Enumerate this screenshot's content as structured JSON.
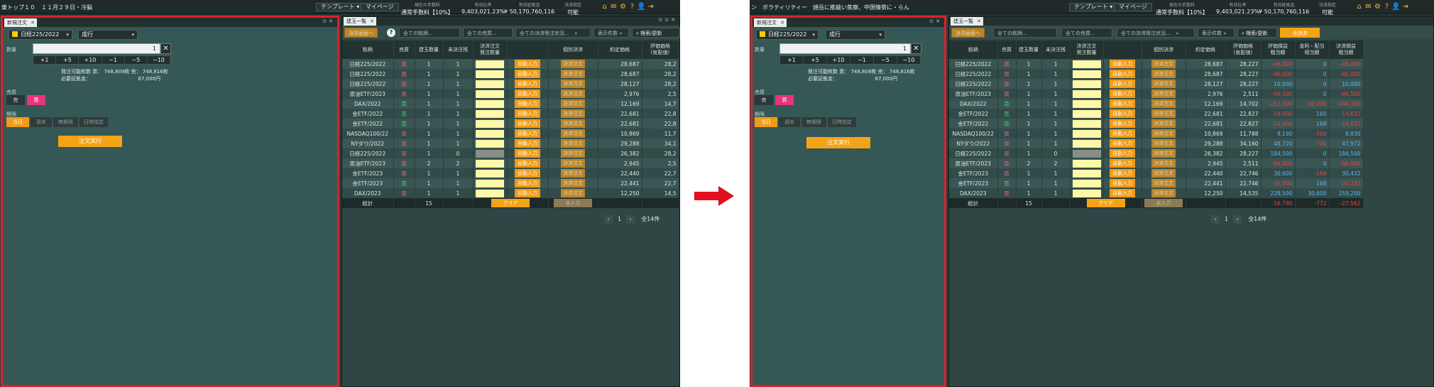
{
  "left": {
    "topbar": {
      "ticker": "東トップ１０　１１月２９日・冷脳",
      "template_label": "テンプレート",
      "mypage_label": "マイページ",
      "stats": [
        {
          "label": "現在の手数料",
          "value": "通常手数料【10%】"
        },
        {
          "label": "有効比率",
          "value": "9,403,021.23%"
        },
        {
          "label": "有効証拠金",
          "value": "¥ 50,170,760,116"
        },
        {
          "label": "決済指定",
          "value": "可能"
        }
      ],
      "icons": [
        "⌂",
        "✉",
        "⚙",
        "?",
        "👤",
        "⇥"
      ]
    },
    "order_panel": {
      "tab": "新規注文",
      "symbol": "日経225/2022",
      "order_type": "成行",
      "qty_label": "数量",
      "qty_value": "1",
      "steps": [
        "+1",
        "+5",
        "+10",
        "−1",
        "−5",
        "−10"
      ],
      "info_line1": "発注可能枚数 買： 748,809枚 売： 748,816枚",
      "info_line2": "必要証拠金：　　　　　　　　　　67,000円",
      "side_label": "売買",
      "sell": "売",
      "buy": "買",
      "period_label": "期限",
      "periods": [
        "当日",
        "週末",
        "無期限",
        "日時指定"
      ],
      "execute": "注文実行"
    },
    "positions": {
      "tab": "建玉一覧",
      "toolbar": {
        "settle_all": "決済画面へ",
        "all_products": "全ての銘柄...",
        "all_sides": "全ての売買...",
        "all_status": "全ての決済発注状況...",
        "display_count": "表示件数",
        "search": "検索/更新"
      },
      "headers": [
        "銘柄",
        "売買",
        "建玉数量",
        "未決注残",
        "決済注文\n発注数量",
        "",
        "個別決済",
        "約定価格",
        "評価価格\n(気配値)"
      ],
      "rows": [
        {
          "name": "日経225/2022",
          "side": "買",
          "qty": "1",
          "open": "1",
          "auto": "自動入力",
          "settle": "決済注文",
          "price": "28,687",
          "eval": "28,2"
        },
        {
          "name": "日経225/2022",
          "side": "買",
          "qty": "1",
          "open": "1",
          "auto": "自動入力",
          "settle": "決済注文",
          "price": "28,687",
          "eval": "28,2"
        },
        {
          "name": "日経225/2022",
          "side": "買",
          "qty": "1",
          "open": "1",
          "auto": "自動入力",
          "settle": "決済注文",
          "price": "28,127",
          "eval": "28,2"
        },
        {
          "name": "原油ETF/2023",
          "side": "買",
          "qty": "1",
          "open": "1",
          "auto": "自動入力",
          "settle": "決済注文",
          "price": "2,976",
          "eval": "2,5"
        },
        {
          "name": "DAX/2022",
          "side": "売",
          "qty": "1",
          "open": "1",
          "auto": "自動入力",
          "settle": "決済注文",
          "price": "12,169",
          "eval": "14,7"
        },
        {
          "name": "金ETF/2022",
          "side": "売",
          "qty": "1",
          "open": "1",
          "auto": "自動入力",
          "settle": "決済注文",
          "price": "22,681",
          "eval": "22,8"
        },
        {
          "name": "金ETF/2022",
          "side": "売",
          "qty": "1",
          "open": "1",
          "auto": "自動入力",
          "settle": "決済注文",
          "price": "22,681",
          "eval": "22,8"
        },
        {
          "name": "NASDAQ100/22",
          "side": "買",
          "qty": "1",
          "open": "1",
          "auto": "自動入力",
          "settle": "決済注文",
          "price": "10,869",
          "eval": "11,7"
        },
        {
          "name": "NYダウ/2022",
          "side": "買",
          "qty": "1",
          "open": "1",
          "auto": "自動入力",
          "settle": "決済注文",
          "price": "29,288",
          "eval": "34,1"
        },
        {
          "name": "日経225/2022",
          "side": "買",
          "qty": "1",
          "open": "0",
          "auto": "自動入力",
          "settle": "決済注文",
          "price": "26,382",
          "eval": "28,2"
        },
        {
          "name": "原油ETF/2023",
          "side": "買",
          "qty": "2",
          "open": "2",
          "auto": "自動入力",
          "settle": "決済注文",
          "price": "2,945",
          "eval": "2,5"
        },
        {
          "name": "金ETF/2023",
          "side": "買",
          "qty": "1",
          "open": "1",
          "auto": "自動入力",
          "settle": "決済注文",
          "price": "22,440",
          "eval": "22,7"
        },
        {
          "name": "金ETF/2023",
          "side": "売",
          "qty": "1",
          "open": "1",
          "auto": "自動入力",
          "settle": "決済注文",
          "price": "22,441",
          "eval": "22,7"
        },
        {
          "name": "DAX/2023",
          "side": "買",
          "qty": "1",
          "open": "1",
          "auto": "自動入力",
          "settle": "決済注文",
          "price": "12,250",
          "eval": "14,5"
        }
      ],
      "total": {
        "label": "総計",
        "qty": "15",
        "clear": "クリア",
        "all_input": "全入力"
      },
      "pager": {
        "prev": "‹",
        "page": "1",
        "next": "›",
        "count": "全14件"
      }
    }
  },
  "right": {
    "topbar": {
      "ticker": "ン　ボラティリティー　焼岳に推敲い焦察、中国情勢に・らん",
      "template_label": "テンプレート",
      "mypage_label": "マイページ",
      "stats": [
        {
          "label": "現在の手数料",
          "value": "通常手数料【10%】"
        },
        {
          "label": "有効比率",
          "value": "9,403,021.23%"
        },
        {
          "label": "有効証拠金",
          "value": "¥ 50,170,760,116"
        },
        {
          "label": "決済指定",
          "value": "可能"
        }
      ],
      "icons": [
        "⌂",
        "✉",
        "⚙",
        "?",
        "👤",
        "⇥"
      ]
    },
    "order_panel": {
      "tab": "新規注文",
      "symbol": "日経225/2022",
      "order_type": "成行",
      "qty_label": "数量",
      "qty_value": "1",
      "steps": [
        "+1",
        "+5",
        "+10",
        "−1",
        "−5",
        "−10"
      ],
      "info_line1": "発注可能枚数 買： 748,809枚 売： 748,816枚",
      "info_line2": "必要証拠金：　　　　　　　　67,000円",
      "side_label": "売買",
      "sell": "売",
      "buy": "買",
      "period_label": "期限",
      "periods": [
        "当日",
        "週末",
        "無期限",
        "日時指定"
      ],
      "execute": "注文実行"
    },
    "positions": {
      "tab": "建玉一覧",
      "toolbar": {
        "settle_all": "決済画面へ",
        "all_products": "全ての銘柄...",
        "all_sides": "全ての売買...",
        "all_status": "全ての決済発注状況...",
        "display_count": "表示件数",
        "search": "検索/更新",
        "bulk": "全決済"
      },
      "headers": [
        "銘柄",
        "売買",
        "建玉数量",
        "未決注残",
        "決済注文\n発注数量",
        "",
        "個別決済",
        "約定価格",
        "評価価格\n(気配値)",
        "評価損益\n粗当額",
        "金利・配当\n相当額",
        "決済損益\n粗当額"
      ],
      "rows": [
        {
          "name": "日経225/2022",
          "side": "買",
          "qty": "1",
          "open": "1",
          "auto": "自動入力",
          "settle": "決済注文",
          "price": "28,687",
          "eval": "28,227",
          "pl": "-46,000",
          "int": "0",
          "settle_pl": "-46,000"
        },
        {
          "name": "日経225/2022",
          "side": "買",
          "qty": "1",
          "open": "1",
          "auto": "自動入力",
          "settle": "決済注文",
          "price": "28,687",
          "eval": "28,227",
          "pl": "-46,000",
          "int": "0",
          "settle_pl": "-46,000"
        },
        {
          "name": "日経225/2022",
          "side": "買",
          "qty": "1",
          "open": "1",
          "auto": "自動入力",
          "settle": "決済注文",
          "price": "28,127",
          "eval": "28,227",
          "pl": "10,000",
          "int": "0",
          "settle_pl": "10,000"
        },
        {
          "name": "原油ETF/2023",
          "side": "買",
          "qty": "1",
          "open": "1",
          "auto": "自動入力",
          "settle": "決済注文",
          "price": "2,976",
          "eval": "2,511",
          "pl": "-46,500",
          "int": "0",
          "settle_pl": "-46,500"
        },
        {
          "name": "DAX/2022",
          "side": "売",
          "qty": "1",
          "open": "1",
          "auto": "自動入力",
          "settle": "決済注文",
          "price": "12,169",
          "eval": "14,702",
          "pl": "-253,300",
          "int": "-30,000",
          "settle_pl": "-294,300"
        },
        {
          "name": "金ETF/2022",
          "side": "売",
          "qty": "1",
          "open": "1",
          "auto": "自動入力",
          "settle": "決済注文",
          "price": "22,681",
          "eval": "22,827",
          "pl": "-14,600",
          "int": "160",
          "settle_pl": "-14,632"
        },
        {
          "name": "金ETF/2022",
          "side": "売",
          "qty": "1",
          "open": "1",
          "auto": "自動入力",
          "settle": "決済注文",
          "price": "22,681",
          "eval": "22,827",
          "pl": "-14,600",
          "int": "168",
          "settle_pl": "-14,632"
        },
        {
          "name": "NASDAQ100/22",
          "side": "買",
          "qty": "1",
          "open": "1",
          "auto": "自動入力",
          "settle": "決済注文",
          "price": "10,869",
          "eval": "11,788",
          "pl": "9,190",
          "int": "-360",
          "settle_pl": "8,830"
        },
        {
          "name": "NYダウ/2022",
          "side": "買",
          "qty": "1",
          "open": "1",
          "auto": "自動入力",
          "settle": "決済注文",
          "price": "29,288",
          "eval": "34,160",
          "pl": "48,720",
          "int": "-748",
          "settle_pl": "47,972"
        },
        {
          "name": "日経225/2022",
          "side": "買",
          "qty": "1",
          "open": "0",
          "auto": "自動入力",
          "settle": "決済注文",
          "price": "26,382",
          "eval": "28,227",
          "pl": "184,500",
          "int": "0",
          "settle_pl": "184,500"
        },
        {
          "name": "原油ETF/2023",
          "side": "買",
          "qty": "2",
          "open": "2",
          "auto": "自動入力",
          "settle": "決済注文",
          "price": "2,945",
          "eval": "2,511",
          "pl": "-86,800",
          "int": "0",
          "settle_pl": "-86,800"
        },
        {
          "name": "金ETF/2023",
          "side": "買",
          "qty": "1",
          "open": "1",
          "auto": "自動入力",
          "settle": "決済注文",
          "price": "22,440",
          "eval": "22,746",
          "pl": "30,600",
          "int": "-168",
          "settle_pl": "30,432"
        },
        {
          "name": "金ETF/2023",
          "side": "売",
          "qty": "1",
          "open": "1",
          "auto": "自動入力",
          "settle": "決済注文",
          "price": "22,441",
          "eval": "22,746",
          "pl": "-30,500",
          "int": "168",
          "settle_pl": "-30,332"
        },
        {
          "name": "DAX/2023",
          "side": "買",
          "qty": "1",
          "open": "1",
          "auto": "自動入力",
          "settle": "決済注文",
          "price": "12,250",
          "eval": "14,535",
          "pl": "228,500",
          "int": "30,600",
          "settle_pl": "259,200"
        }
      ],
      "total": {
        "label": "総計",
        "qty": "15",
        "clear": "クリア",
        "all_input": "全入力",
        "pl": "-16,790",
        "int": "-772",
        "settle_pl": "-27,562"
      },
      "pager": {
        "prev": "‹",
        "page": "1",
        "next": "›",
        "count": "全14件"
      }
    }
  },
  "colors": {
    "highlight": "#d9232b",
    "accent": "#f4a316",
    "buy": "#f25a8a",
    "sell": "#4fdf7a",
    "negative": "#ff3b3b",
    "positive": "#56b6ff",
    "arrow": "#e0101e"
  }
}
